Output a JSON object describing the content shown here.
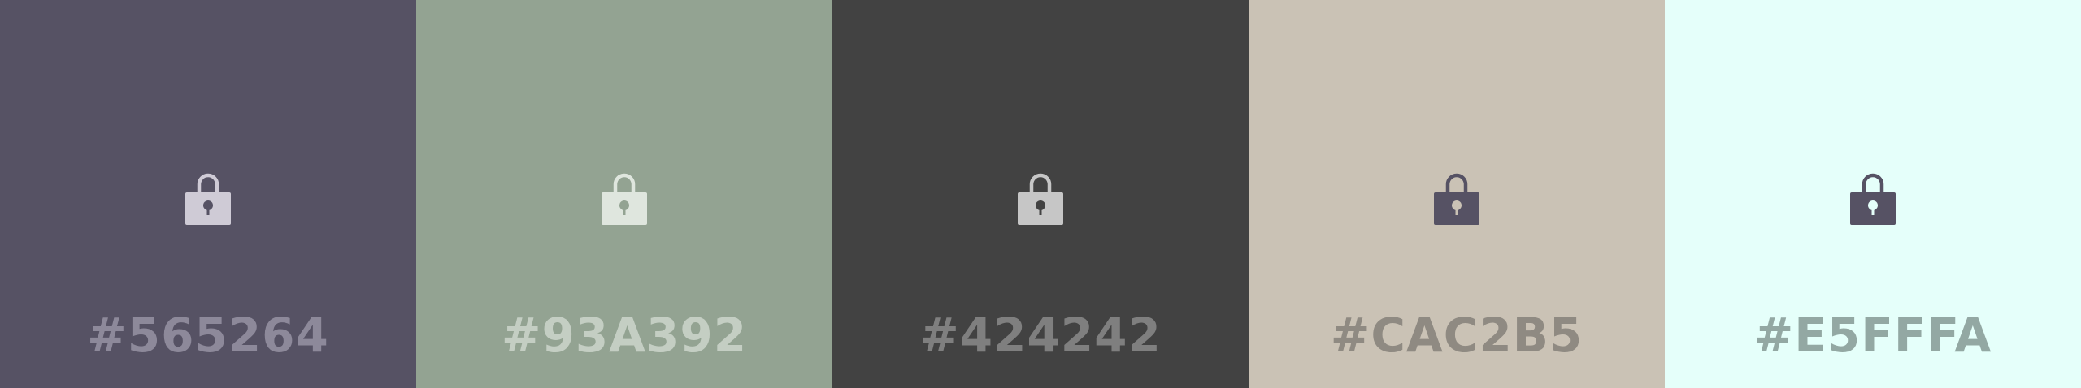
{
  "palette": {
    "swatches": [
      {
        "hex": "#565264",
        "color": "#565264",
        "icon": "lock-icon",
        "lock_body": "#cfcbd6",
        "lock_hole": "#565264",
        "label_color": "#8d899a"
      },
      {
        "hex": "#93A392",
        "color": "#93A392",
        "icon": "lock-icon",
        "lock_body": "#dfe6de",
        "lock_hole": "#93A392",
        "label_color": "#c4cec3"
      },
      {
        "hex": "#424242",
        "color": "#424242",
        "icon": "lock-icon",
        "lock_body": "#c6c6c6",
        "lock_hole": "#424242",
        "label_color": "#7f7f7f"
      },
      {
        "hex": "#CAC2B5",
        "color": "#CAC2B5",
        "icon": "lock-icon",
        "lock_body": "#565264",
        "lock_hole": "#CAC2B5",
        "label_color": "#8f8a82"
      },
      {
        "hex": "#E5FFFA",
        "color": "#E5FFFA",
        "icon": "lock-icon",
        "lock_body": "#565264",
        "lock_hole": "#E5FFFA",
        "label_color": "#93a8a3"
      }
    ]
  }
}
